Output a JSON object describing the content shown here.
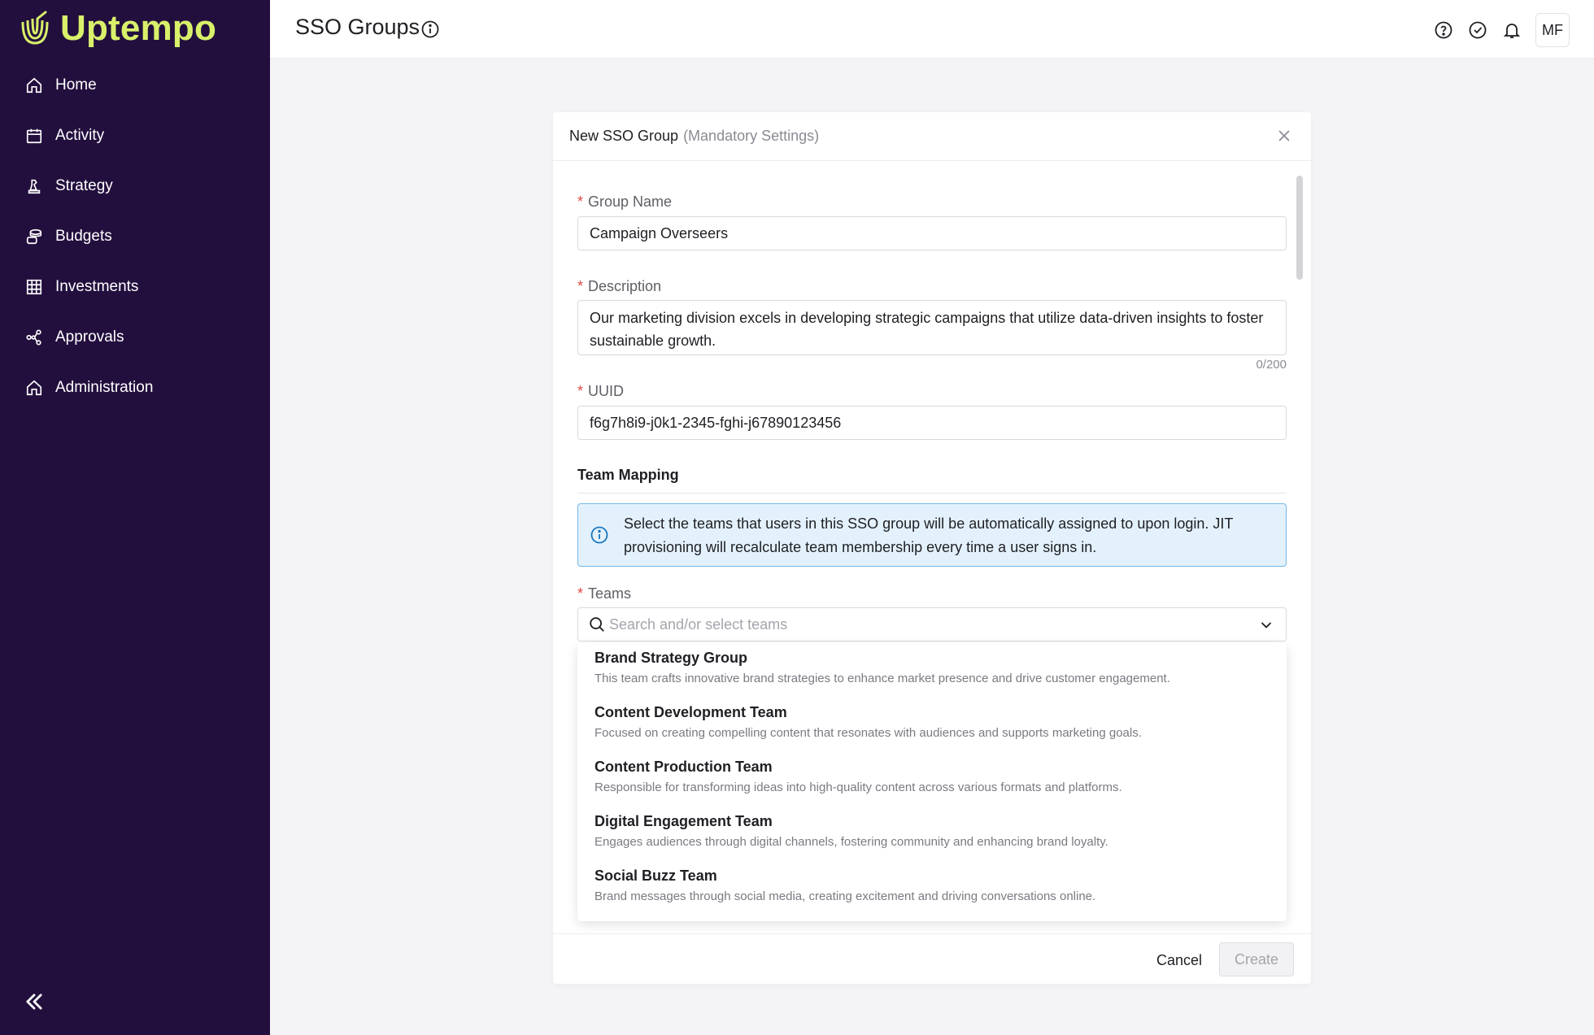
{
  "app": {
    "logo_text": "Uptempo"
  },
  "sidebar": {
    "items": [
      {
        "label": "Home",
        "icon": "home-icon"
      },
      {
        "label": "Activity",
        "icon": "calendar-icon"
      },
      {
        "label": "Strategy",
        "icon": "chess-piece-icon"
      },
      {
        "label": "Budgets",
        "icon": "coins-icon"
      },
      {
        "label": "Investments",
        "icon": "table-grid-icon"
      },
      {
        "label": "Approvals",
        "icon": "share-nodes-icon"
      },
      {
        "label": "Administration",
        "icon": "home-icon"
      }
    ],
    "collapse_icon": "double-chevron-left-icon"
  },
  "header": {
    "title": "SSO Groups",
    "avatar_initials": "MF",
    "icons": [
      "help-icon",
      "check-circle-icon",
      "bell-icon"
    ]
  },
  "modal": {
    "title": "New SSO Group",
    "subtitle": "(Mandatory Settings)",
    "fields": {
      "group_name": {
        "label": "Group Name",
        "value": "Campaign Overseers"
      },
      "description": {
        "label": "Description",
        "value": "Our marketing division excels in developing strategic campaigns that utilize data-driven insights to foster sustainable growth.",
        "counter": "0/200"
      },
      "uuid": {
        "label": "UUID",
        "value": "f6g7h8i9-j0k1-2345-fghi-j67890123456"
      }
    },
    "team_mapping": {
      "title": "Team Mapping",
      "info_text": "Select the teams that users in this SSO group will be automatically assigned to upon login. JIT provisioning will recalculate team membership every time a user signs in.",
      "teams_label": "Teams",
      "teams_placeholder": "Search and/or select teams",
      "options": [
        {
          "name": "Brand Strategy Group",
          "description": "This team crafts innovative brand strategies to enhance market presence and drive customer engagement."
        },
        {
          "name": "Content Development Team",
          "description": "Focused on creating compelling content that resonates with audiences and supports marketing goals."
        },
        {
          "name": "Content Production Team",
          "description": "Responsible for transforming ideas into high-quality content across various formats and platforms."
        },
        {
          "name": "Digital Engagement Team",
          "description": "Engages audiences through digital channels, fostering community and enhancing brand loyalty."
        },
        {
          "name": "Social Buzz Team",
          "description": "Brand messages through social media, creating excitement and driving conversations online."
        }
      ]
    },
    "footer": {
      "cancel_label": "Cancel",
      "create_label": "Create"
    }
  },
  "colors": {
    "sidebar_bg": "#230f3e",
    "logo_accent": "#d8f06a",
    "info_bg": "#e3f1fc",
    "info_border": "#77b8e8",
    "required": "#e04747"
  }
}
